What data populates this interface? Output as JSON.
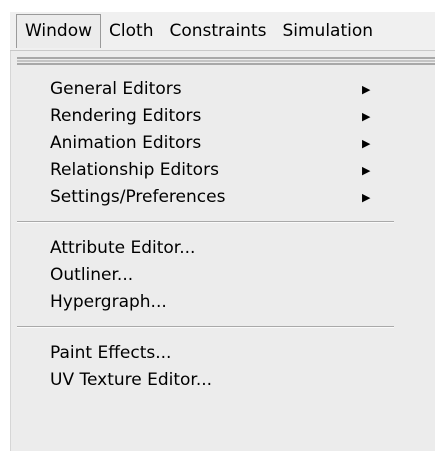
{
  "menubar": {
    "items": [
      {
        "label": "Window"
      },
      {
        "label": "Cloth"
      },
      {
        "label": "Constraints"
      },
      {
        "label": "Simulation"
      }
    ]
  },
  "window_menu": {
    "group1": [
      {
        "label": "General Editors",
        "submenu_icon": "submenu-arrow-icon"
      },
      {
        "label": "Rendering Editors",
        "submenu_icon": "submenu-arrow-icon"
      },
      {
        "label": "Animation Editors",
        "submenu_icon": "submenu-arrow-icon"
      },
      {
        "label": "Relationship Editors",
        "submenu_icon": "submenu-arrow-icon"
      },
      {
        "label": "Settings/Preferences",
        "submenu_icon": "submenu-arrow-icon"
      }
    ],
    "group2": [
      {
        "label": "Attribute Editor..."
      },
      {
        "label": "Outliner..."
      },
      {
        "label": "Hypergraph..."
      }
    ],
    "group3": [
      {
        "label": "Paint Effects..."
      },
      {
        "label": "UV Texture Editor..."
      }
    ]
  }
}
